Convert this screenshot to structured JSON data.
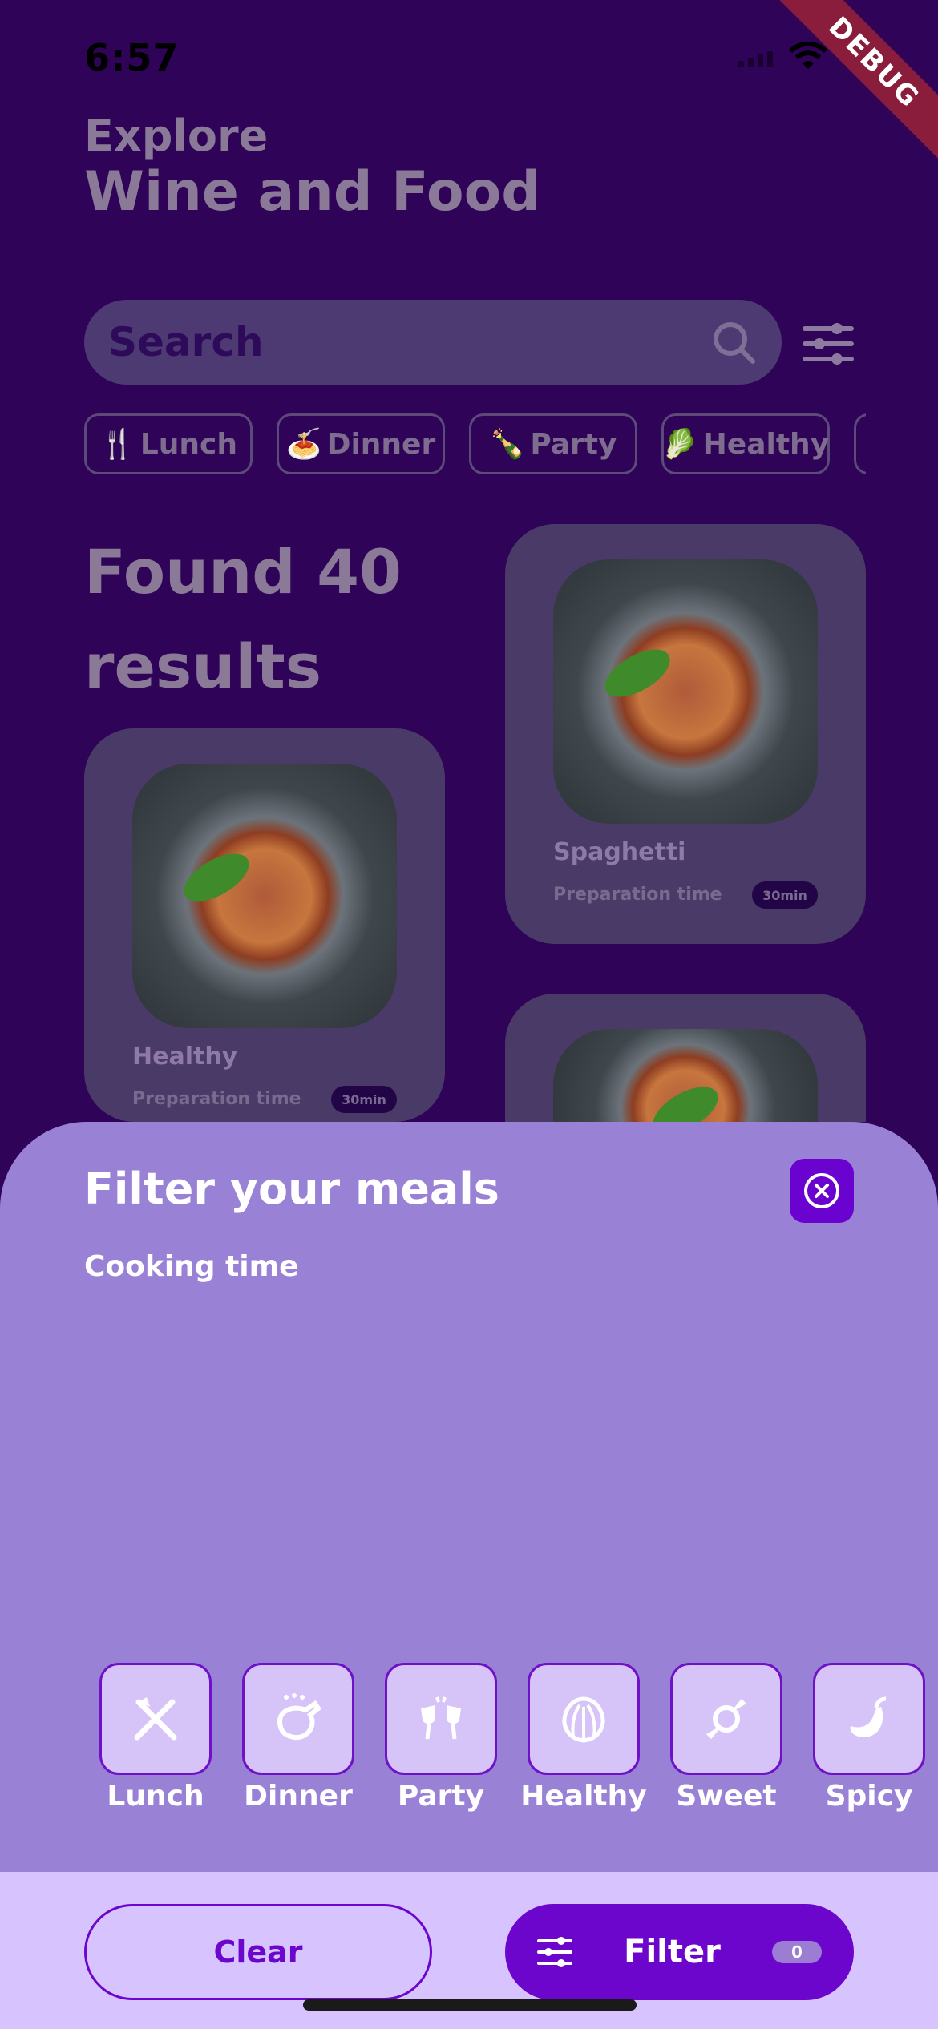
{
  "status": {
    "time": "6:57"
  },
  "debug_banner": "DEBUG",
  "header": {
    "eyebrow": "Explore",
    "title": "Wine and Food"
  },
  "search": {
    "placeholder": "Search"
  },
  "chips": [
    {
      "emoji": "🍴",
      "label": "Lunch"
    },
    {
      "emoji": "🍝",
      "label": "Dinner"
    },
    {
      "emoji": "🍾",
      "label": "Party"
    },
    {
      "emoji": "🥬",
      "label": "Healthy"
    }
  ],
  "results": {
    "text": "Found 40 results"
  },
  "cards": [
    {
      "title": "Spaghetti",
      "prep_label": "Preparation time",
      "time": "30min"
    },
    {
      "title": "Healthy",
      "prep_label": "Preparation time",
      "time": "30min"
    }
  ],
  "sheet": {
    "title": "Filter your meals",
    "section": "Cooking time",
    "categories": [
      {
        "label": "Lunch",
        "icon": "fork-knife-icon"
      },
      {
        "label": "Dinner",
        "icon": "roast-chicken-icon"
      },
      {
        "label": "Party",
        "icon": "toast-glasses-icon"
      },
      {
        "label": "Healthy",
        "icon": "lettuce-icon"
      },
      {
        "label": "Sweet",
        "icon": "candy-icon"
      },
      {
        "label": "Spicy",
        "icon": "pepper-icon"
      }
    ]
  },
  "footer": {
    "clear_label": "Clear",
    "filter_label": "Filter",
    "filter_count": "0"
  },
  "colors": {
    "accent": "#6c06cd",
    "sheet": "#9982d6",
    "footer": "#d7c3fd",
    "background": "#2e0358"
  }
}
